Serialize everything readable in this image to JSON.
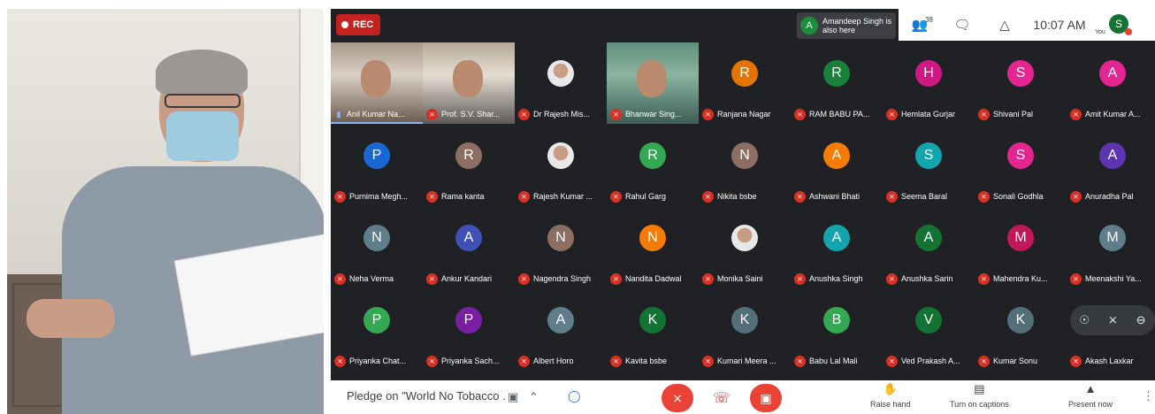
{
  "meet": {
    "rec_label": "REC",
    "notice": {
      "avatar": "A",
      "text": "Amandeep Singh is also here"
    },
    "participants_count": "38",
    "time": "10:07 AM",
    "self": {
      "label": "You",
      "initial": "S"
    }
  },
  "tiles": [
    {
      "name": "Anil Kumar Na...",
      "type": "video",
      "speaking": true
    },
    {
      "name": "Prof. S.V. Shar...",
      "type": "video"
    },
    {
      "name": "Dr Rajesh Mis...",
      "type": "photo"
    },
    {
      "name": "Bhanwar Sing...",
      "type": "video"
    },
    {
      "name": "Ranjana Nagar",
      "initial": "R",
      "color": "#e37400"
    },
    {
      "name": "RAM BABU PA...",
      "initial": "R",
      "color": "#188038"
    },
    {
      "name": "Hemlata Gurjar",
      "initial": "H",
      "color": "#d01884"
    },
    {
      "name": "Shivani Pal",
      "initial": "S",
      "color": "#e52592"
    },
    {
      "name": "Amit Kumar A...",
      "initial": "A",
      "color": "#e52592"
    },
    {
      "name": "Purnima Megh...",
      "initial": "P",
      "color": "#1967d2"
    },
    {
      "name": "Rama kanta",
      "initial": "R",
      "color": "#8d6e63"
    },
    {
      "name": "Rajesh Kumar ...",
      "type": "photo"
    },
    {
      "name": "Rahul Garg",
      "initial": "R",
      "color": "#34a853"
    },
    {
      "name": "Nikita bsbe",
      "initial": "N",
      "color": "#8d6e63"
    },
    {
      "name": "Ashwani Bhati",
      "initial": "A",
      "color": "#f57c00"
    },
    {
      "name": "Seema Baral",
      "initial": "S",
      "color": "#12a4af"
    },
    {
      "name": "Sonali Godhla",
      "initial": "S",
      "color": "#e52592"
    },
    {
      "name": "Anuradha Pal",
      "initial": "A",
      "color": "#5e35b1"
    },
    {
      "name": "Neha Verma",
      "initial": "N",
      "color": "#607d8b"
    },
    {
      "name": "Ankur Kandari",
      "initial": "A",
      "color": "#3f51b5"
    },
    {
      "name": "Nagendra Singh",
      "initial": "N",
      "color": "#8d6e63"
    },
    {
      "name": "Nandita Dadwal",
      "initial": "N",
      "color": "#f57c00"
    },
    {
      "name": "Monika Saini",
      "type": "photo"
    },
    {
      "name": "Anushka Singh",
      "initial": "A",
      "color": "#12a4af"
    },
    {
      "name": "Anushka Sarin",
      "initial": "A",
      "color": "#137333"
    },
    {
      "name": "Mahendra Ku...",
      "initial": "M",
      "color": "#c2185b"
    },
    {
      "name": "Meenakshi Ya...",
      "initial": "M",
      "color": "#607d8b"
    },
    {
      "name": "Priyanka Chat...",
      "initial": "P",
      "color": "#34a853"
    },
    {
      "name": "Priyanka Sach...",
      "initial": "P",
      "color": "#7b1fa2"
    },
    {
      "name": "Albert Horo",
      "initial": "A",
      "color": "#607d8b"
    },
    {
      "name": "Kavita bsbe",
      "initial": "K",
      "color": "#137333"
    },
    {
      "name": "Kumari Meera ...",
      "initial": "K",
      "color": "#546e7a"
    },
    {
      "name": "Babu Lal Mali",
      "initial": "B",
      "color": "#34a853"
    },
    {
      "name": "Ved Prakash A...",
      "initial": "V",
      "color": "#137333"
    },
    {
      "name": "Kumar Sonu",
      "initial": "K",
      "color": "#546e7a"
    },
    {
      "name": "Akash Laxkar",
      "type": "hover"
    }
  ],
  "bottom": {
    "meeting_name": "Pledge on \"World No Tobacco ...",
    "raise_hand": "Raise hand",
    "captions": "Turn on captions",
    "present": "Present now"
  }
}
